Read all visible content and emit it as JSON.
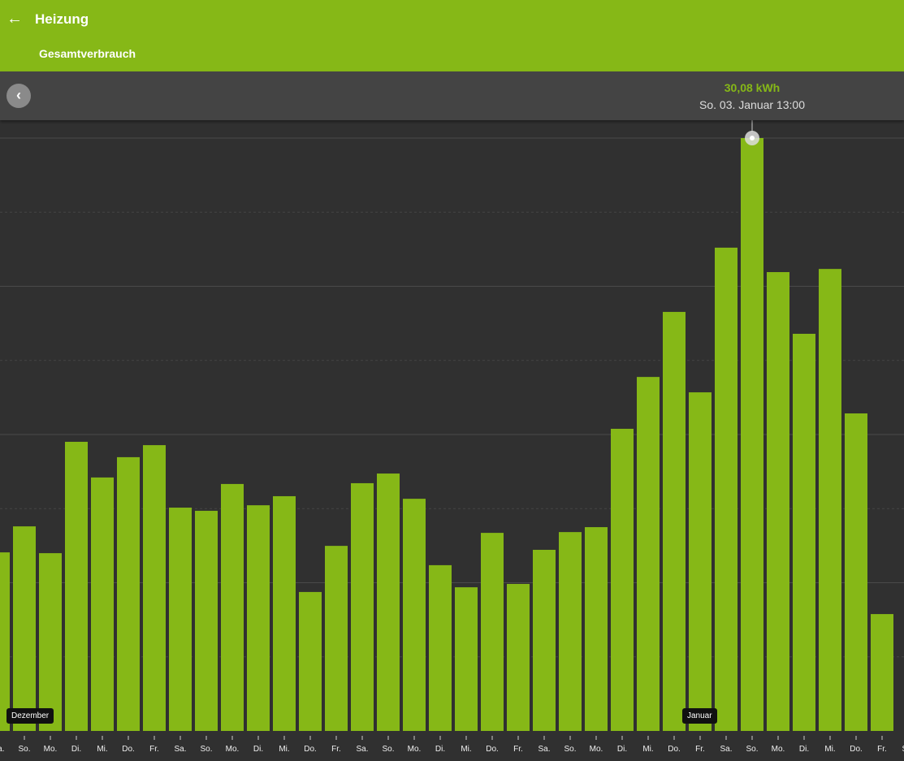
{
  "header": {
    "title": "Heizung",
    "subtitle": "Gesamtverbrauch",
    "back_icon": "arrow-left-icon"
  },
  "toolbar": {
    "prev_icon": "chevron-left-icon"
  },
  "tooltip": {
    "value": "30,08 kWh",
    "date": "So. 03. Januar 13:00"
  },
  "colors": {
    "accent": "#86b817",
    "background": "#303030",
    "toolbar": "#444444"
  },
  "chart_data": {
    "type": "bar",
    "unit": "kWh",
    "ylim": [
      0,
      30.08
    ],
    "grid": true,
    "selected_index": 29,
    "categories": [
      "Sa.",
      "So.",
      "Mo.",
      "Di.",
      "Mi.",
      "Do.",
      "Fr.",
      "Sa.",
      "So.",
      "Mo.",
      "Di.",
      "Mi.",
      "Do.",
      "Fr.",
      "Sa.",
      "So.",
      "Mo.",
      "Di.",
      "Mi.",
      "Do.",
      "Fr.",
      "Sa.",
      "So.",
      "Mo.",
      "Di.",
      "Mi.",
      "Do.",
      "Fr.",
      "Sa.",
      "So.",
      "Mo.",
      "Di.",
      "Mi.",
      "Do.",
      "Fr.",
      "Sa."
    ],
    "values": [
      9.06,
      10.38,
      9.02,
      14.67,
      12.86,
      13.89,
      14.5,
      11.33,
      11.17,
      12.53,
      11.45,
      11.91,
      7.05,
      9.39,
      12.57,
      13.06,
      11.78,
      8.41,
      7.29,
      10.05,
      7.46,
      9.19,
      10.09,
      10.34,
      15.33,
      17.96,
      21.26,
      17.18,
      24.52,
      30.08,
      23.28,
      20.15,
      23.44,
      16.11,
      5.93,
      null
    ],
    "month_labels": [
      {
        "label": "Dezember",
        "index": 1
      },
      {
        "label": "Januar",
        "index": 27
      }
    ]
  }
}
